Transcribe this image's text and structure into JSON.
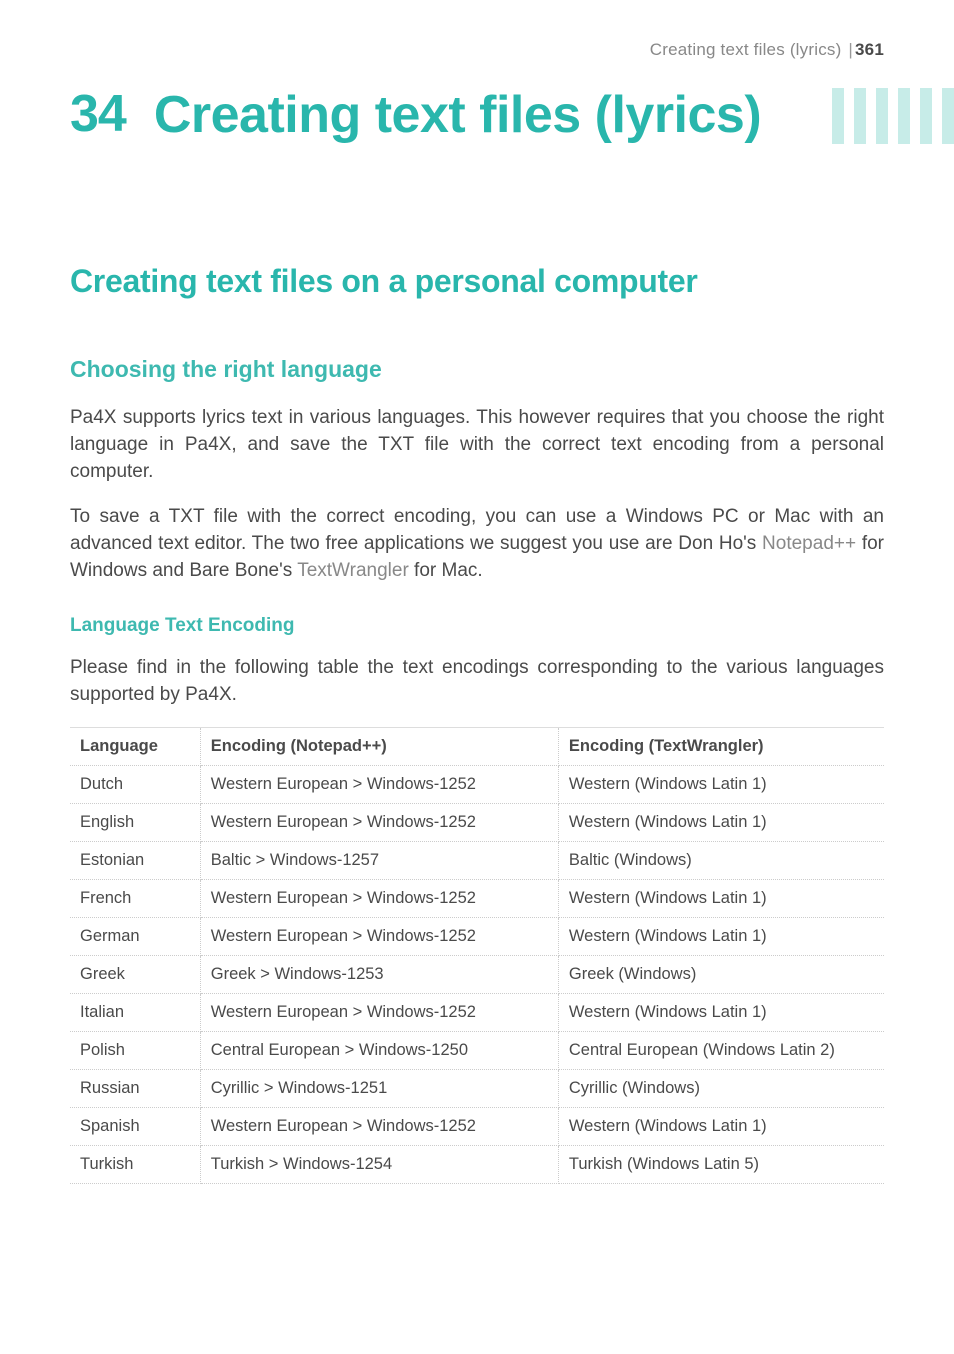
{
  "runningHeader": {
    "title": "Creating text files (lyrics)",
    "pageNumber": "361"
  },
  "chapter": {
    "number": "34",
    "title": "Creating text files (lyrics)"
  },
  "section": {
    "title": "Creating text files on a personal computer"
  },
  "subheading": "Choosing the right language",
  "para1": "Pa4X supports lyrics text in various languages. This however requires that you choose the right language in Pa4X, and save the TXT file with the correct text encoding from a personal computer.",
  "para2a": "To save a TXT file with the correct encoding, you can use a Windows PC or Mac with an advanced text editor. The two free applications we suggest you use are Don Ho's ",
  "para2_link1": "Notepad++",
  "para2b": " for Windows and Bare Bone's ",
  "para2_link2": "TextWrangler",
  "para2c": " for Mac.",
  "subSubheading": "Language Text Encoding",
  "para3": "Please find in the following table the text encodings corresponding to the various languages supported by Pa4X.",
  "table": {
    "headers": {
      "c1": "Language",
      "c2": "Encoding (Notepad++)",
      "c3": "Encoding (TextWrangler)"
    },
    "rows": [
      {
        "lang": "Dutch",
        "np": "Western European > Windows-1252",
        "tw": "Western (Windows Latin 1)"
      },
      {
        "lang": "English",
        "np": "Western European > Windows-1252",
        "tw": "Western (Windows Latin 1)"
      },
      {
        "lang": "Estonian",
        "np": "Baltic > Windows-1257",
        "tw": "Baltic (Windows)"
      },
      {
        "lang": "French",
        "np": "Western European > Windows-1252",
        "tw": "Western (Windows Latin 1)"
      },
      {
        "lang": "German",
        "np": "Western European > Windows-1252",
        "tw": "Western (Windows Latin 1)"
      },
      {
        "lang": "Greek",
        "np": "Greek > Windows-1253",
        "tw": "Greek (Windows)"
      },
      {
        "lang": "Italian",
        "np": "Western European > Windows-1252",
        "tw": "Western (Windows Latin 1)"
      },
      {
        "lang": "Polish",
        "np": "Central European > Windows-1250",
        "tw": "Central European (Windows Latin 2)"
      },
      {
        "lang": "Russian",
        "np": "Cyrillic > Windows-1251",
        "tw": "Cyrillic (Windows)"
      },
      {
        "lang": "Spanish",
        "np": "Western European > Windows-1252",
        "tw": "Western (Windows Latin 1)"
      },
      {
        "lang": "Turkish",
        "np": "Turkish > Windows-1254",
        "tw": "Turkish (Windows Latin 5)"
      }
    ]
  }
}
